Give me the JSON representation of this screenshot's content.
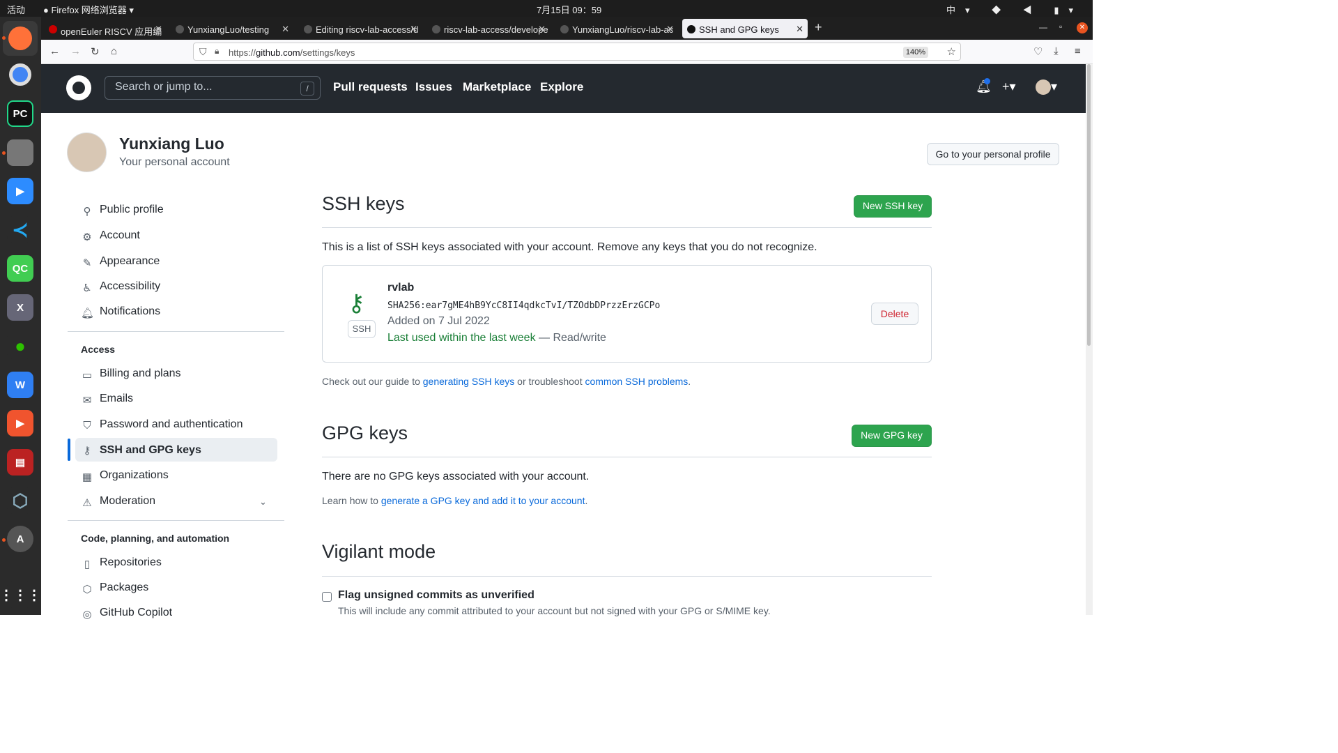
{
  "system": {
    "activities": "活动",
    "app_name": "Firefox 网络浏览器",
    "clock": "7月15日 09：59",
    "tray_lang": "中"
  },
  "tabs": [
    {
      "label": "openEuler RISCV 应用编"
    },
    {
      "label": "YunxiangLuo/testing"
    },
    {
      "label": "Editing riscv-lab-access/d"
    },
    {
      "label": "riscv-lab-access/develope"
    },
    {
      "label": "YunxiangLuo/riscv-lab-ac"
    },
    {
      "label": "SSH and GPG keys"
    }
  ],
  "browser": {
    "url_prefix": "https://",
    "url_host": "github.com",
    "url_path": "/settings/keys",
    "zoom": "140%"
  },
  "header": {
    "search_placeholder": "Search or jump to...",
    "search_key": "/",
    "nav": [
      "Pull requests",
      "Issues",
      "Marketplace",
      "Explore"
    ]
  },
  "profile": {
    "name": "Yunxiang Luo",
    "subtitle": "Your personal account",
    "goto_button": "Go to your personal profile"
  },
  "sidebar": {
    "group1": [
      "Public profile",
      "Account",
      "Appearance",
      "Accessibility",
      "Notifications"
    ],
    "access_heading": "Access",
    "group2": [
      "Billing and plans",
      "Emails",
      "Password and authentication",
      "SSH and GPG keys",
      "Organizations",
      "Moderation"
    ],
    "code_heading": "Code, planning, and automation",
    "group3": [
      "Repositories",
      "Packages",
      "GitHub Copilot"
    ]
  },
  "ssh": {
    "title": "SSH keys",
    "new_button": "New SSH key",
    "description": "This is a list of SSH keys associated with your account. Remove any keys that you do not recognize.",
    "key": {
      "name": "rvlab",
      "fingerprint": "SHA256:ear7gME4hB9YcC8II4qdkcTvI/TZOdbDPrzzErzGCPo",
      "added": "Added on 7 Jul 2022",
      "last_used": "Last used within the last week",
      "access": " — Read/write",
      "badge": "SSH",
      "delete_button": "Delete"
    },
    "guide_prefix": "Check out our guide to ",
    "guide_link1": "generating SSH keys",
    "guide_mid": " or troubleshoot ",
    "guide_link2": "common SSH problems",
    "guide_suffix": "."
  },
  "gpg": {
    "title": "GPG keys",
    "new_button": "New GPG key",
    "empty": "There are no GPG keys associated with your account.",
    "learn_prefix": "Learn how to ",
    "learn_link": "generate a GPG key and add it to your account",
    "learn_suffix": "."
  },
  "vigilant": {
    "title": "Vigilant mode",
    "checkbox_label": "Flag unsigned commits as unverified",
    "note": "This will include any commit attributed to your account but not signed with your GPG or S/MIME key."
  }
}
